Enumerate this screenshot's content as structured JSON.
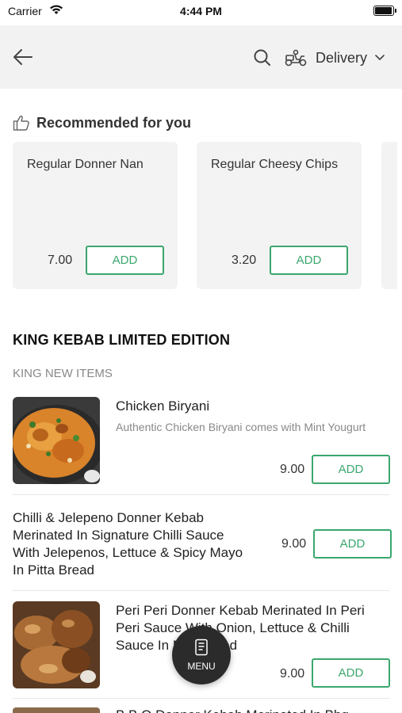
{
  "status_bar": {
    "carrier": "Carrier",
    "time": "4:44 PM"
  },
  "nav": {
    "back_icon": "back-arrow-icon",
    "search_icon": "search-icon",
    "delivery_icon": "scooter-icon",
    "delivery_label": "Delivery",
    "delivery_chevron_icon": "chevron-down-icon"
  },
  "recommended": {
    "icon": "thumbs-up-icon",
    "title": "Recommended for you",
    "items": [
      {
        "name": "Regular Donner Nan",
        "price": "7.00",
        "add_label": "ADD"
      },
      {
        "name": "Regular Cheesy Chips",
        "price": "3.20",
        "add_label": "ADD"
      }
    ]
  },
  "section": {
    "title": "KING KEBAB LIMITED EDITION",
    "subsection": "KING NEW ITEMS"
  },
  "menu_items": [
    {
      "name": "Chicken Biryani",
      "description": "Authentic Chicken Biryani comes with Mint Yougurt",
      "price": "9.00",
      "add_label": "ADD"
    },
    {
      "name": "Chilli & Jelepeno Donner Kebab Merinated In Signature Chilli Sauce With Jelepenos, Lettuce & Spicy Mayo In Pitta Bread",
      "price": "9.00",
      "add_label": "ADD"
    },
    {
      "name": "Peri Peri Donner Kebab Merinated In Peri Peri Sauce With Onion, Lettuce & Chilli Sauce In Nan Bread",
      "price": "9.00",
      "add_label": "ADD"
    },
    {
      "name": "B.B.Q Donner Kebab Merinated In Bbq"
    }
  ],
  "fab": {
    "icon": "menu-book-icon",
    "label": "MENU"
  },
  "colors": {
    "accent_green": "#3aa76d",
    "nav_background": "#f2f2f2",
    "card_background": "#f3f3f3",
    "fab_background": "#2b2b2b"
  }
}
